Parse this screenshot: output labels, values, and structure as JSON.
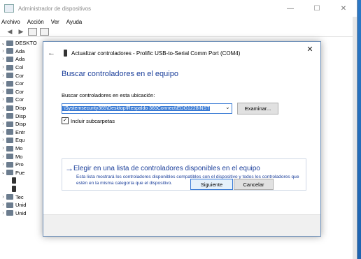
{
  "window": {
    "title": "Administrador de dispositivos",
    "controls": [
      "—",
      "☐",
      "✕"
    ]
  },
  "menu": [
    "Archivo",
    "Acción",
    "Ver",
    "Ayuda"
  ],
  "tree": {
    "root": "DESKTO",
    "items": [
      {
        "label": "Ada",
        "expander": "›"
      },
      {
        "label": "Ada",
        "expander": "›"
      },
      {
        "label": "Col",
        "expander": "›"
      },
      {
        "label": "Cor",
        "expander": "›"
      },
      {
        "label": "Cor",
        "expander": "›"
      },
      {
        "label": "Cor",
        "expander": "›"
      },
      {
        "label": "Cor",
        "expander": "›"
      },
      {
        "label": "Disp",
        "expander": "›"
      },
      {
        "label": "Disp",
        "expander": "›"
      },
      {
        "label": "Disp",
        "expander": "›"
      },
      {
        "label": "Entr",
        "expander": "›"
      },
      {
        "label": "Equ",
        "expander": "›"
      },
      {
        "label": "Mo",
        "expander": "›"
      },
      {
        "label": "Mo",
        "expander": "›"
      },
      {
        "label": "Pro",
        "expander": "›"
      },
      {
        "label": "Pue",
        "expander": "⌄"
      },
      {
        "label": "",
        "expander": ""
      },
      {
        "label": "",
        "expander": ""
      },
      {
        "label": "Tec",
        "expander": "›"
      },
      {
        "label": "Unid",
        "expander": "›"
      },
      {
        "label": "Unid",
        "expander": "›"
      }
    ]
  },
  "dialog": {
    "close": "✕",
    "back": "←",
    "title": "Actualizar controladores - Prolific USB-to-Serial Comm Port (COM4)",
    "heading": "Buscar controladores en el equipo",
    "location_label": "Buscar controladores en esta ubicación:",
    "path_value": "\\Systemsecurity365\\Desktop\\Respaldo 365Connect\\EDG1228INST",
    "dropdown_arrow": "⌄",
    "browse_label": "Examinar...",
    "checkbox_label": "Incluir subcarpetas",
    "checkbox_checked": true,
    "choose_arrow": "→",
    "choose_title": "Elegir en una lista de controladores disponibles en el equipo",
    "choose_desc": "Esta lista mostrará los controladores disponibles compatibles con el dispositivo y todos los controladores que estén en la misma categoría que el dispositivo.",
    "next_label": "Siguiente",
    "cancel_label": "Cancelar"
  },
  "colors": {
    "accent": "#3a7bd5",
    "link": "#1a3e9a",
    "desktop": "#1e63b0"
  }
}
